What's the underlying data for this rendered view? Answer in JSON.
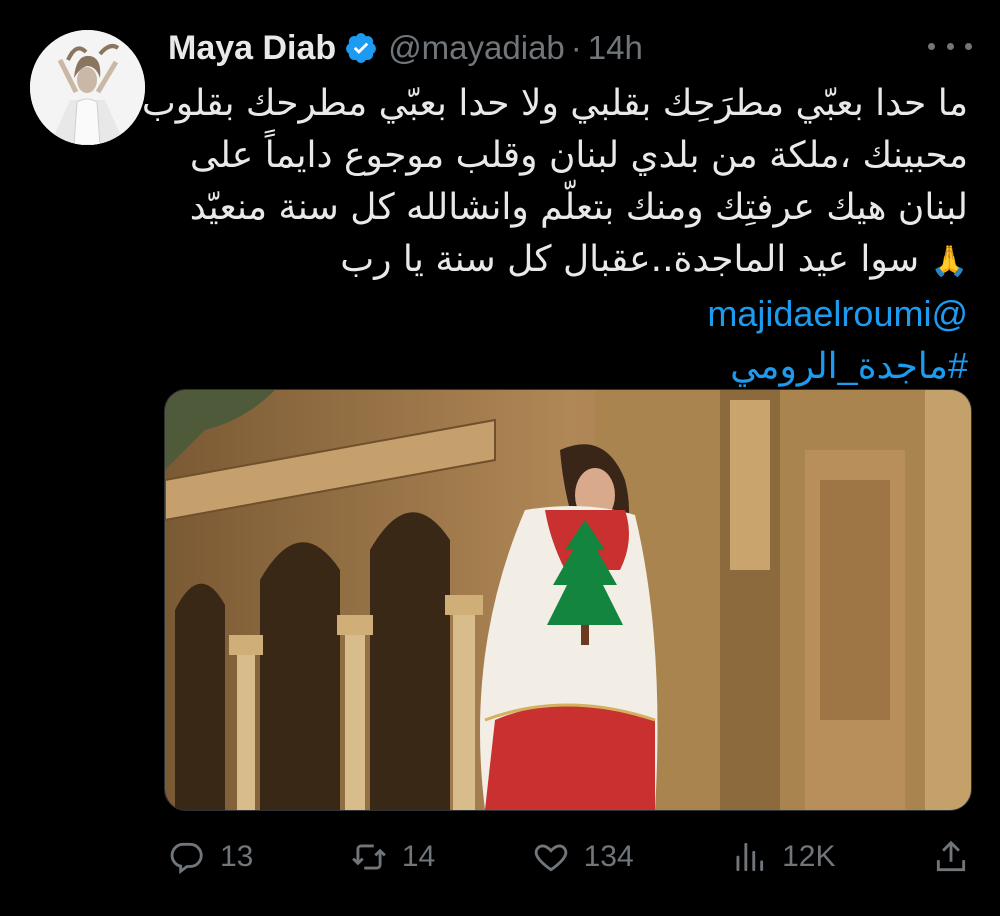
{
  "tweet": {
    "author_name": "Maya Diab",
    "handle": "@mayadiab",
    "separator": "·",
    "time": "14h",
    "text_lines": [
      "ما حدا بعبّي مطرَحِك بقلبي ولا حدا بعبّي مطرحك بقلوب",
      "محبينك ،ملكة من بلدي لبنان وقلب موجوع دايماً على",
      "لبنان هيك عرفتِك ومنك بتعلّم وانشالله كل سنة منعيّد",
      "سوا عيد الماجدة..عقبال كل سنة يا رب"
    ],
    "emoji": "🙏",
    "mention": "@majidaelroumi",
    "hashtag": "#ماجدة_الرومي"
  },
  "actions": {
    "replies": "13",
    "retweets": "14",
    "likes": "134",
    "views": "12K"
  },
  "colors": {
    "background": "#000000",
    "text": "#e7e9ea",
    "muted": "#71767b",
    "link": "#1d9bf0",
    "verified": "#1d9bf0"
  },
  "icons": [
    "more-icon",
    "verified-badge-icon",
    "reply-icon",
    "retweet-icon",
    "like-icon",
    "views-icon",
    "share-icon"
  ]
}
